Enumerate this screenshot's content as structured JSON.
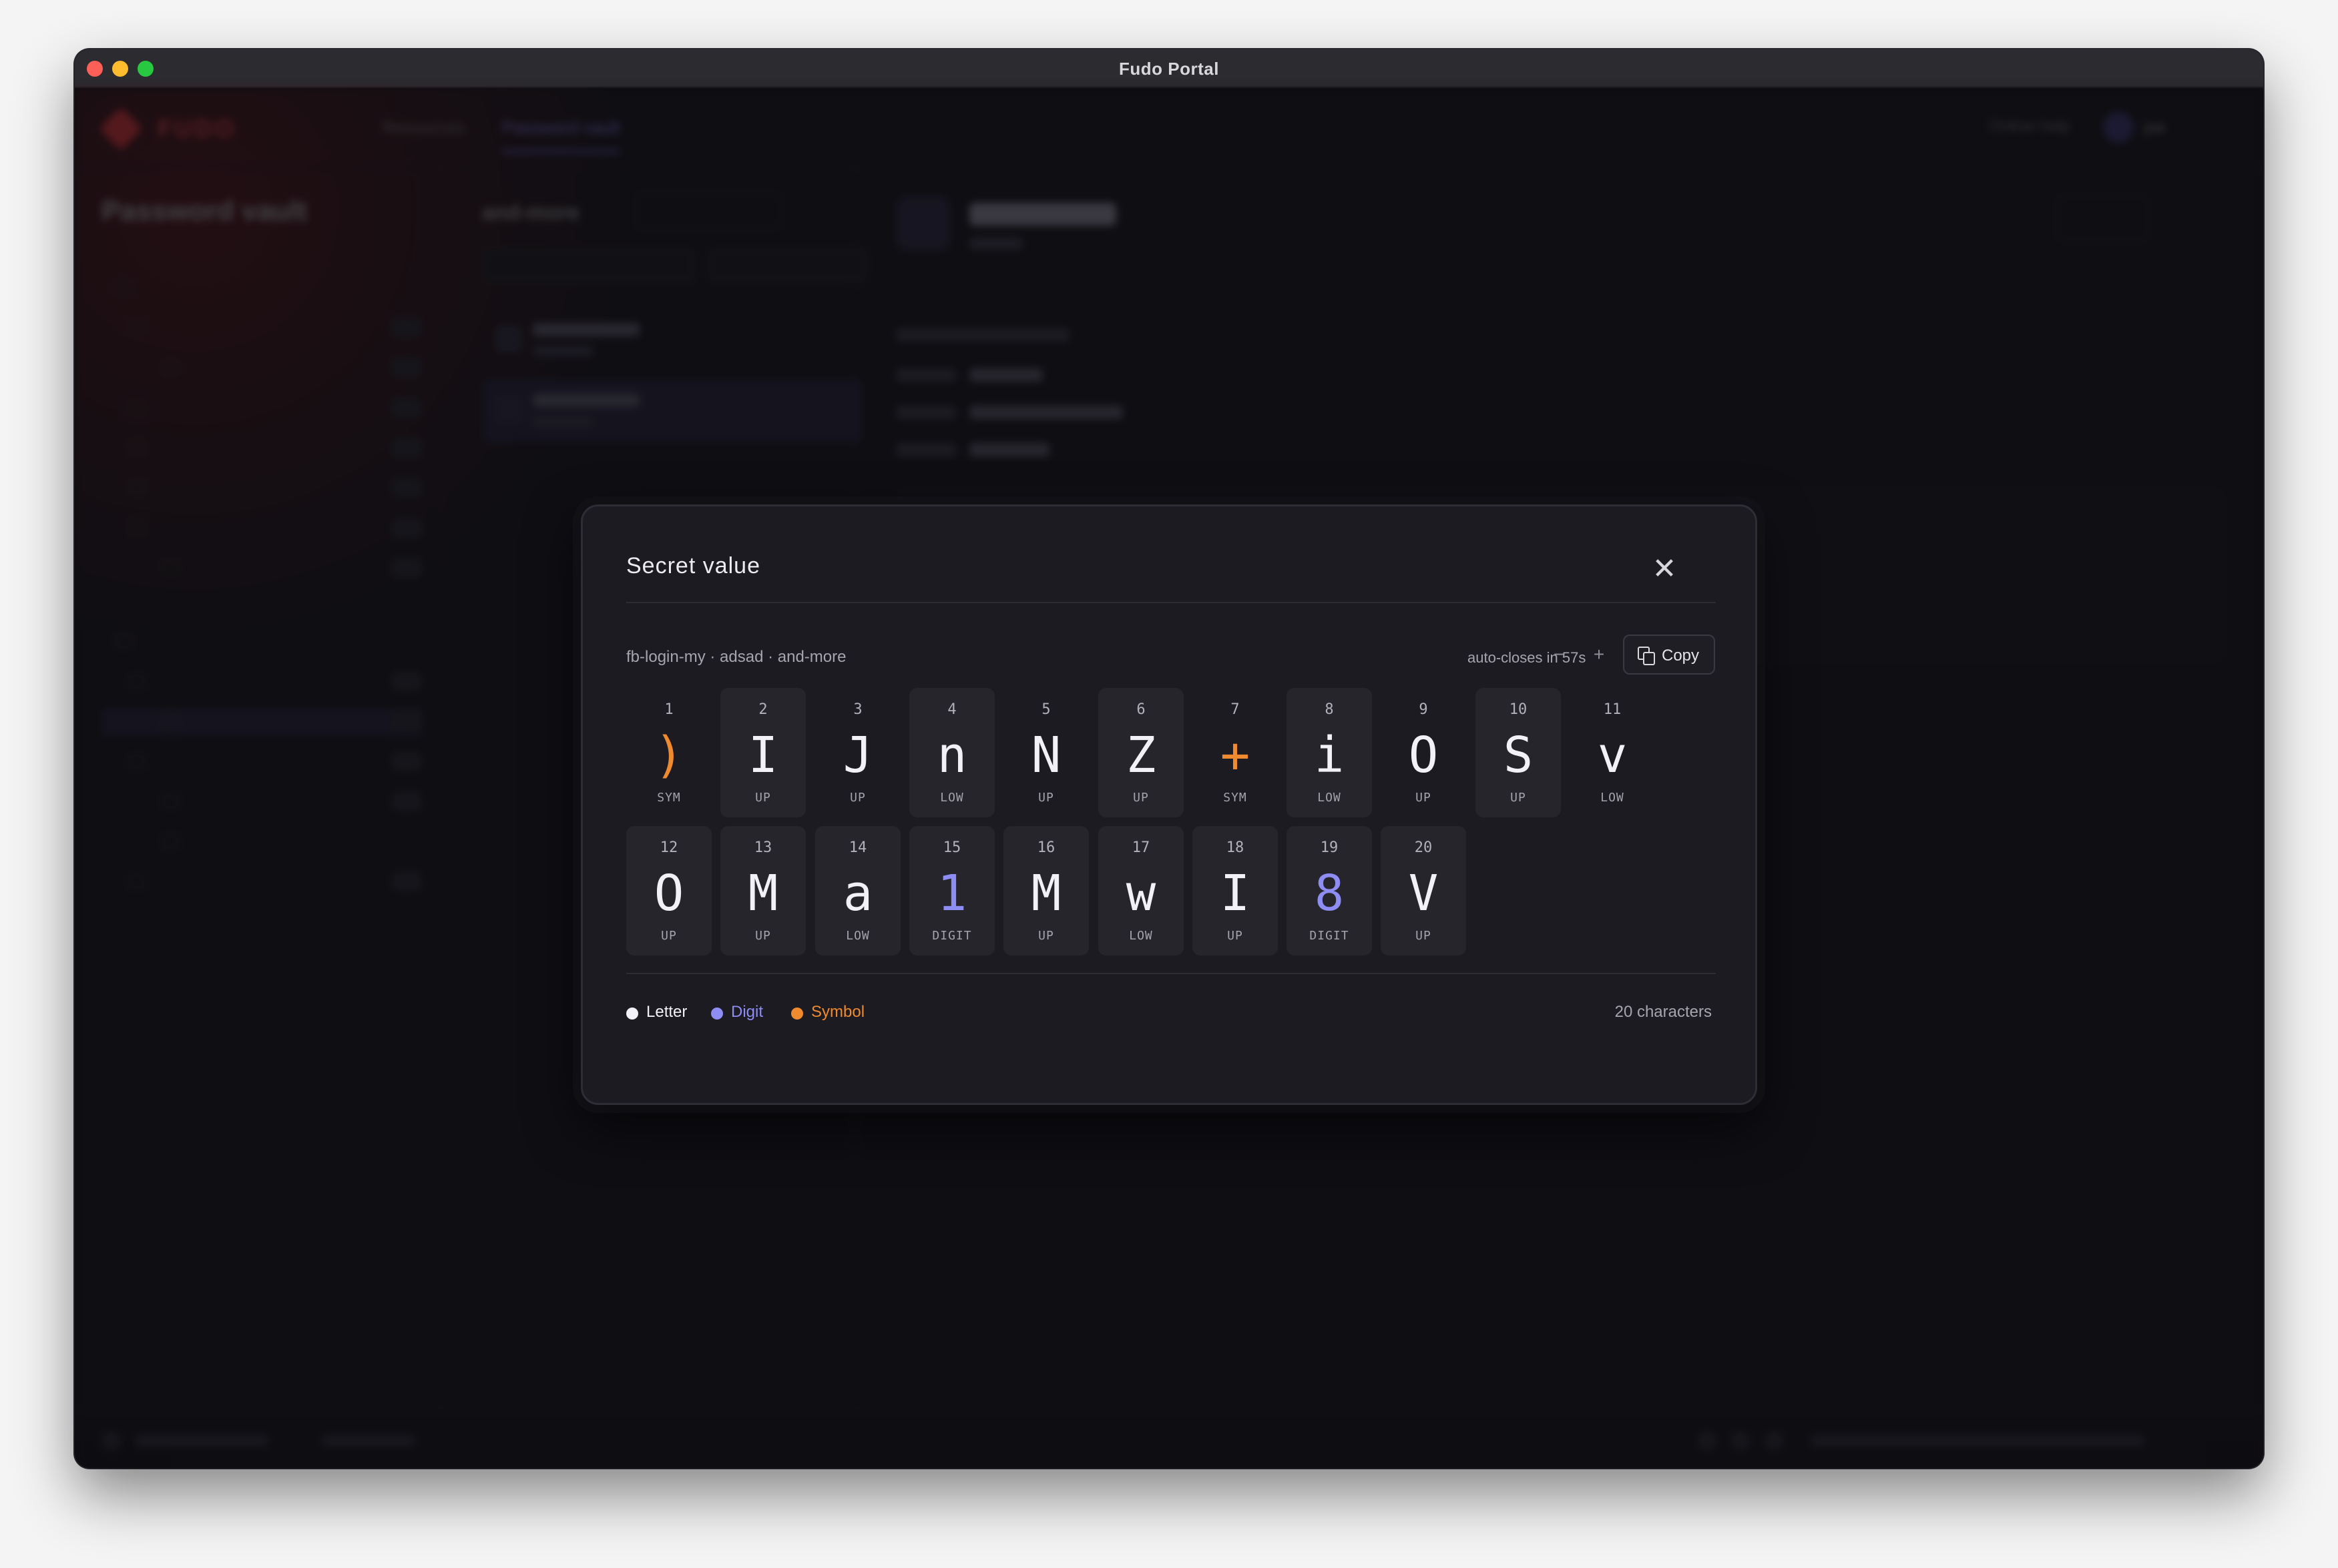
{
  "window": {
    "title": "Fudo Portal"
  },
  "background_app": {
    "brand": "FUDO",
    "nav": [
      "Resources",
      "Password vault"
    ],
    "active_nav": "Password vault",
    "help": "Online help",
    "user": "joe",
    "sidebar_title": "Password vault",
    "list_title": "and-more"
  },
  "modal": {
    "title": "Secret value",
    "path": "fb-login-my · adsad · and-more",
    "auto_close": "auto-closes in 57s",
    "decrease": "−",
    "increase": "+",
    "copy_label": "Copy",
    "count_label": "20 characters",
    "characters": [
      {
        "index": "1",
        "char": ")",
        "type": "SYM",
        "class": "symbol"
      },
      {
        "index": "2",
        "char": "I",
        "type": "UP",
        "class": "letter"
      },
      {
        "index": "3",
        "char": "J",
        "type": "UP",
        "class": "letter"
      },
      {
        "index": "4",
        "char": "n",
        "type": "LOW",
        "class": "letter"
      },
      {
        "index": "5",
        "char": "N",
        "type": "UP",
        "class": "letter"
      },
      {
        "index": "6",
        "char": "Z",
        "type": "UP",
        "class": "letter"
      },
      {
        "index": "7",
        "char": "+",
        "type": "SYM",
        "class": "symbol"
      },
      {
        "index": "8",
        "char": "i",
        "type": "LOW",
        "class": "letter"
      },
      {
        "index": "9",
        "char": "O",
        "type": "UP",
        "class": "letter"
      },
      {
        "index": "10",
        "char": "S",
        "type": "UP",
        "class": "letter"
      },
      {
        "index": "11",
        "char": "v",
        "type": "LOW",
        "class": "letter"
      },
      {
        "index": "12",
        "char": "O",
        "type": "UP",
        "class": "letter"
      },
      {
        "index": "13",
        "char": "M",
        "type": "UP",
        "class": "letter"
      },
      {
        "index": "14",
        "char": "a",
        "type": "LOW",
        "class": "letter"
      },
      {
        "index": "15",
        "char": "1",
        "type": "DIGIT",
        "class": "digit"
      },
      {
        "index": "16",
        "char": "M",
        "type": "UP",
        "class": "letter"
      },
      {
        "index": "17",
        "char": "w",
        "type": "LOW",
        "class": "letter"
      },
      {
        "index": "18",
        "char": "I",
        "type": "UP",
        "class": "letter"
      },
      {
        "index": "19",
        "char": "8",
        "type": "DIGIT",
        "class": "digit"
      },
      {
        "index": "20",
        "char": "V",
        "type": "UP",
        "class": "letter"
      }
    ],
    "legend": [
      {
        "label": "Letter",
        "color": "#f2f2f6"
      },
      {
        "label": "Digit",
        "color": "#8d8df4"
      },
      {
        "label": "Symbol",
        "color": "#f08a2e"
      }
    ]
  },
  "icons": {
    "close": "close-icon",
    "copy": "copy-icon"
  }
}
